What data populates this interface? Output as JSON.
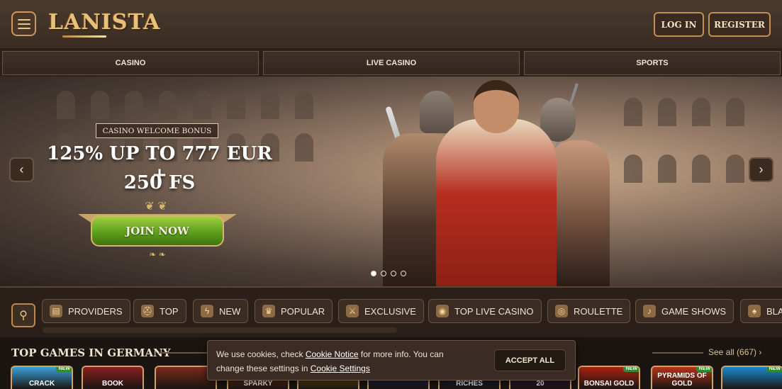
{
  "header": {
    "brand": "LANISTA",
    "login_label": "LOG IN",
    "register_label": "REGISTER"
  },
  "nav": {
    "tabs": [
      {
        "label": "CASINO"
      },
      {
        "label": "LIVE CASINO"
      },
      {
        "label": "SPORTS"
      }
    ]
  },
  "hero": {
    "badge": "CASINO WELCOME BONUS",
    "headline_line1": "125% UP TO 777 EUR +",
    "headline_line2": "250 FS",
    "cta_label": "JOIN NOW",
    "prev_arrow": "‹",
    "next_arrow": "›",
    "slides_count": 4,
    "active_slide": 1
  },
  "filters": {
    "search_icon": "search-icon",
    "chips": [
      {
        "label": "PROVIDERS",
        "icon": "scroll-icon"
      },
      {
        "label": "TOP",
        "icon": "helmet-icon"
      },
      {
        "label": "NEW",
        "icon": "lightning-icon"
      },
      {
        "label": "POPULAR",
        "icon": "trophy-icon"
      },
      {
        "label": "EXCLUSIVE",
        "icon": "crossed-swords-icon"
      },
      {
        "label": "TOP LIVE CASINO",
        "icon": "coin-icon"
      },
      {
        "label": "ROULETTE",
        "icon": "roulette-icon"
      },
      {
        "label": "GAME SHOWS",
        "icon": "horn-icon"
      },
      {
        "label": "BLA",
        "icon": "cards-icon"
      }
    ]
  },
  "section": {
    "title": "TOP GAMES IN GERMANY",
    "see_all": "See all (667) ›"
  },
  "games": [
    {
      "name": "CRACK",
      "new": "NEW",
      "color": "#3aa0d8"
    },
    {
      "name": "BOOK",
      "new": "",
      "color": "#8a1f1f"
    },
    {
      "name": "",
      "new": "",
      "color": "#7a2a1a"
    },
    {
      "name": "SPARKY",
      "new": "",
      "color": "#b0461a"
    },
    {
      "name": "",
      "new": "",
      "color": "#c58a1c"
    },
    {
      "name": "",
      "new": "",
      "color": "#2a3f8a"
    },
    {
      "name": "RICHES",
      "new": "",
      "color": "#1d2a6a"
    },
    {
      "name": "20",
      "new": "",
      "color": "#4a1d6a"
    },
    {
      "name": "BONSAI GOLD",
      "new": "NEW",
      "color": "#a82010"
    },
    {
      "name": "PYRAMIDS OF GOLD",
      "new": "NEW",
      "color": "#b5321a"
    },
    {
      "name": "",
      "new": "NEW",
      "color": "#1a8ad0"
    }
  ],
  "cookie": {
    "text_pre": "We use cookies, check ",
    "link1": "Cookie Notice",
    "text_mid": " for more info. You can change these settings in ",
    "link2": "Cookie Settings",
    "accept_label": "ACCEPT ALL"
  },
  "colors": {
    "accent_gold": "#c99a5b",
    "cta_green": "#5a9a1a",
    "bg_dark": "#1a1410"
  }
}
